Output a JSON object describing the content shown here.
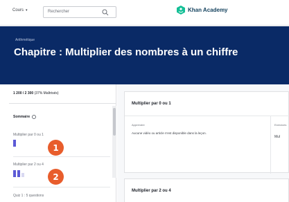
{
  "nav": {
    "explore_label": "Cours",
    "search_placeholder": "Rechercher",
    "logo_text": "Khan Academy"
  },
  "header": {
    "breadcrumb": "Arithmétique",
    "title": "Chapitre : Multiplier des nombres à un chiffre"
  },
  "sidebar": {
    "points_value": "1 200 / 2 300",
    "points_suffix": "(37% Maîtrisés)",
    "summary_label": "Sommaire",
    "lessons": [
      {
        "label": "Multiplier par 0 ou 1",
        "badge": "1",
        "bars_filled": 1,
        "bars_total": 1
      },
      {
        "label": "Multiplier par 2 ou 4",
        "badge": "2",
        "bars_filled": 2,
        "bars_total": 3
      }
    ],
    "footer_item": "Quiz 1 : 5 questions"
  },
  "main": {
    "card1": {
      "title": "Multiplier par 0 ou 1",
      "label": "Apprendre",
      "text": "Aucune vidéo ou article n'est disponible dans la leçon.",
      "col2_label": "Exercices",
      "col2_text": "Mul"
    },
    "card2": {
      "title": "Multiplier par 2 ou 4"
    }
  },
  "colors": {
    "header_bg": "#0a2a66",
    "badge": "#e85d2c",
    "mastery_bar": "#5c5ad6",
    "logo_green": "#14bf96"
  }
}
